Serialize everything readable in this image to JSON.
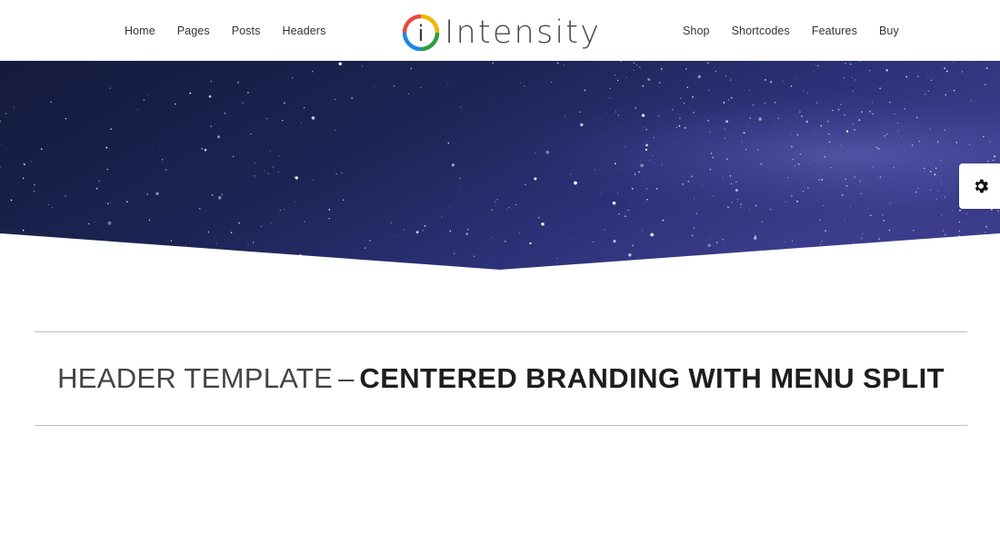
{
  "nav": {
    "left": [
      {
        "label": "Home"
      },
      {
        "label": "Pages"
      },
      {
        "label": "Posts"
      },
      {
        "label": "Headers"
      }
    ],
    "right": [
      {
        "label": "Shop"
      },
      {
        "label": "Shortcodes"
      },
      {
        "label": "Features"
      },
      {
        "label": "Buy"
      }
    ]
  },
  "brand": {
    "letter": "i",
    "name": "Intensity"
  },
  "settings": {
    "icon": "gear-icon"
  },
  "page_title": {
    "light": "HEADER TEMPLATE",
    "separator": "–",
    "bold": "CENTERED BRANDING WITH MENU SPLIT"
  },
  "colors": {
    "text": "#333333",
    "rule": "#bdbdbd",
    "sky_dark": "#141b3c",
    "sky_light": "#3e3e8e",
    "logo_ring": [
      "#e84c3d",
      "#f4b400",
      "#2f9e44",
      "#1e88e5"
    ]
  }
}
